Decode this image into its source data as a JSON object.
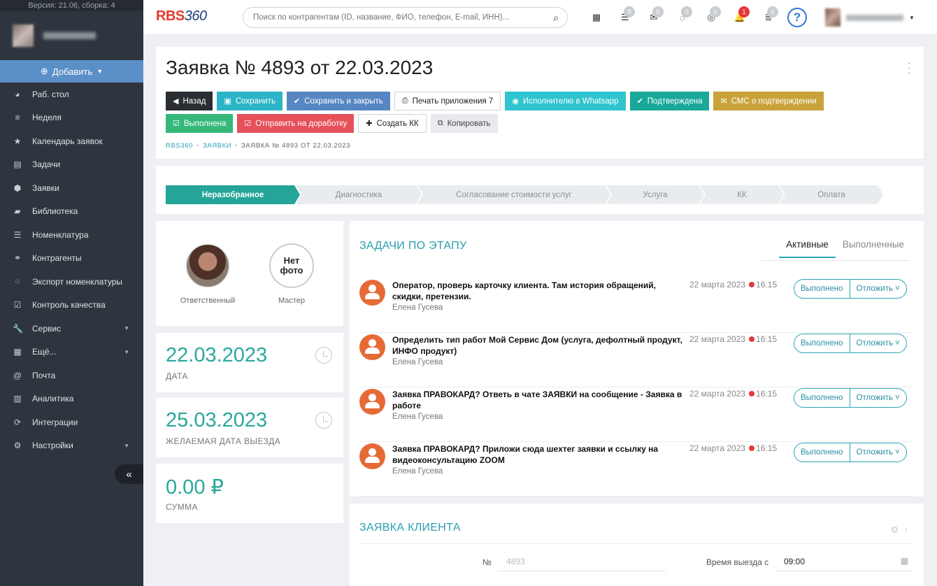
{
  "sidebar": {
    "version": "Версия: 21.06, сборка: 4",
    "add_label": "Добавить",
    "items": [
      {
        "icon": "pie-chart-icon",
        "glyph": "◕",
        "label": "Раб. стол"
      },
      {
        "icon": "list-icon",
        "glyph": "≡",
        "label": "Неделя"
      },
      {
        "icon": "star-icon",
        "glyph": "★",
        "label": "Календарь заявок"
      },
      {
        "icon": "tasks-icon",
        "glyph": "▤",
        "label": "Задачи"
      },
      {
        "icon": "cube-icon",
        "glyph": "⬢",
        "label": "Заявки"
      },
      {
        "icon": "book-icon",
        "glyph": "▰",
        "label": "Библиотека"
      },
      {
        "icon": "list-icon",
        "glyph": "☰",
        "label": "Номенклатура"
      },
      {
        "icon": "users-icon",
        "glyph": "⚭",
        "label": "Контрагенты"
      },
      {
        "icon": "spinner-icon",
        "glyph": "⁘",
        "label": "Экспорт номенклатуры"
      },
      {
        "icon": "checkbox-icon",
        "glyph": "☑",
        "label": "Контроль качества"
      },
      {
        "icon": "wrench-icon",
        "glyph": "🔧",
        "label": "Сервис"
      },
      {
        "icon": "grid-icon",
        "glyph": "▦",
        "label": "Ещё..."
      },
      {
        "icon": "at-icon",
        "glyph": "@",
        "label": "Почта"
      },
      {
        "icon": "bar-chart-icon",
        "glyph": "▥",
        "label": "Аналитика"
      },
      {
        "icon": "refresh-icon",
        "glyph": "⟳",
        "label": "Интеграции"
      },
      {
        "icon": "gear-icon",
        "glyph": "⚙",
        "label": "Настройки"
      }
    ],
    "collapse_glyph": "«"
  },
  "topbar": {
    "logo_a": "RBS",
    "logo_b": "360",
    "search_placeholder": "Поиск по контрагентам (ID, название, ФИО, телефон, E-mail, ИНН)...",
    "icons": [
      {
        "name": "calendar-icon",
        "glyph": "▦",
        "badge": ""
      },
      {
        "name": "list-icon",
        "glyph": "☰",
        "badge": "0"
      },
      {
        "name": "mail-icon",
        "glyph": "✉",
        "badge": "0"
      },
      {
        "name": "chat-icon",
        "glyph": "◌",
        "badge": "0"
      },
      {
        "name": "comments-icon",
        "glyph": "◎",
        "badge": "0"
      },
      {
        "name": "bell-icon",
        "glyph": "🔔",
        "badge": "1"
      },
      {
        "name": "stack-icon",
        "glyph": "≣",
        "badge": "0"
      }
    ],
    "help": "?"
  },
  "header": {
    "title": "Заявка № 4893 от 22.03.2023",
    "buttons_row1": [
      {
        "name": "back-button",
        "cls": "b-dark",
        "icon": "◀",
        "label": "Назад"
      },
      {
        "name": "save-button",
        "cls": "b-teal",
        "icon": "▣",
        "label": "Сохранить"
      },
      {
        "name": "save-close-button",
        "cls": "b-blue",
        "icon": "✔",
        "label": "Сохранить и закрыть"
      },
      {
        "name": "print-button",
        "cls": "b-white",
        "icon": "⎙",
        "label": "Печать приложения 7"
      },
      {
        "name": "whatsapp-button",
        "cls": "b-wa",
        "icon": "◉",
        "label": "Исполнителю в Whatsapp"
      },
      {
        "name": "confirmed-button",
        "cls": "b-green",
        "icon": "✔",
        "label": "Подтверждена"
      },
      {
        "name": "sms-button",
        "cls": "b-gold",
        "icon": "✉",
        "label": "СМС о подтверждении"
      }
    ],
    "buttons_row2": [
      {
        "name": "done-button",
        "cls": "b-lgreen",
        "icon": "☑",
        "label": "Выполнена"
      },
      {
        "name": "rework-button",
        "cls": "b-red",
        "icon": "☑",
        "label": "Отправить на доработку"
      },
      {
        "name": "create-kk-button",
        "cls": "b-white",
        "icon": "✚",
        "label": "Создать КК"
      },
      {
        "name": "copy-button",
        "cls": "b-gray",
        "icon": "⧉",
        "label": "Копировать"
      }
    ],
    "breadcrumb": [
      "RBS360",
      "ЗАЯВКИ",
      "ЗАЯВКА № 4893 ОТ 22.03.2023"
    ]
  },
  "stages": [
    "Неразобранное",
    "Диагностика",
    "Согласование стоимости услуг",
    "Услуга",
    "КК",
    "Оплата"
  ],
  "people": {
    "responsible_label": "Ответственный",
    "master_label": "Мастер",
    "no_photo": "Нет фото"
  },
  "stats": [
    {
      "value": "22.03.2023",
      "label": "ДАТА",
      "clock": true
    },
    {
      "value": "25.03.2023",
      "label": "ЖЕЛАЕМАЯ ДАТА ВЫЕЗДА",
      "clock": true
    },
    {
      "value": "0.00 ₽",
      "label": "СУММА",
      "clock": false
    }
  ],
  "tasks": {
    "title": "ЗАДАЧИ ПО ЭТАПУ",
    "tab_active": "Активные",
    "tab_done": "Выполненные",
    "done_label": "Выполнено",
    "postpone_label": "Отложить ˅",
    "items": [
      {
        "text": "Оператор, проверь карточку клиента. Там история обращений, скидки, претензии.",
        "author": "Елена Гусева",
        "date": "22 марта 2023",
        "time": "16:15"
      },
      {
        "text": "Определить тип работ Мой Сервис Дом (услуга, дефолтный продукт, ИНФО продукт)",
        "author": "Елена Гусева",
        "date": "22 марта 2023",
        "time": "16:15"
      },
      {
        "text": "Заявка ПРАВОКАРД? Ответь в чате ЗАЯВКИ на сообщение - Заявка в работе",
        "author": "Елена Гусева",
        "date": "22 марта 2023",
        "time": "16:15"
      },
      {
        "text": "Заявка ПРАВОКАРД? Приложи сюда шехтег заявки и ссылку на видеоконсультацию ZOOM",
        "author": "Елена Гусева",
        "date": "22 марта 2023",
        "time": "16:15"
      }
    ]
  },
  "client": {
    "title": "ЗАЯВКА КЛИЕНТА",
    "number_label": "№",
    "number_value": "4893",
    "departure_label": "Время выезда с",
    "departure_value": "09:00"
  }
}
